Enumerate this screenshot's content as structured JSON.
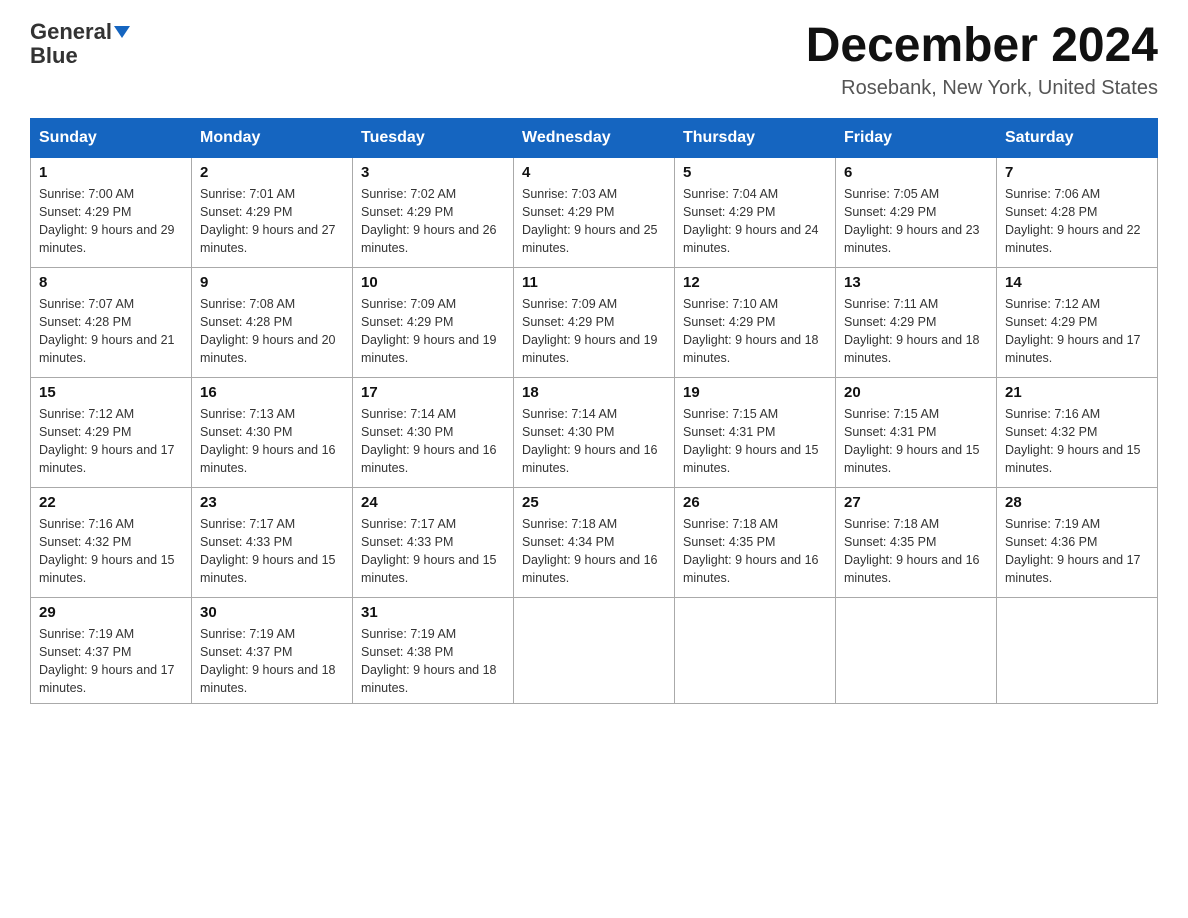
{
  "header": {
    "logo_general": "General",
    "logo_blue": "Blue",
    "month_title": "December 2024",
    "location": "Rosebank, New York, United States"
  },
  "days_of_week": [
    "Sunday",
    "Monday",
    "Tuesday",
    "Wednesday",
    "Thursday",
    "Friday",
    "Saturday"
  ],
  "weeks": [
    [
      {
        "num": "1",
        "sunrise": "7:00 AM",
        "sunset": "4:29 PM",
        "daylight": "9 hours and 29 minutes."
      },
      {
        "num": "2",
        "sunrise": "7:01 AM",
        "sunset": "4:29 PM",
        "daylight": "9 hours and 27 minutes."
      },
      {
        "num": "3",
        "sunrise": "7:02 AM",
        "sunset": "4:29 PM",
        "daylight": "9 hours and 26 minutes."
      },
      {
        "num": "4",
        "sunrise": "7:03 AM",
        "sunset": "4:29 PM",
        "daylight": "9 hours and 25 minutes."
      },
      {
        "num": "5",
        "sunrise": "7:04 AM",
        "sunset": "4:29 PM",
        "daylight": "9 hours and 24 minutes."
      },
      {
        "num": "6",
        "sunrise": "7:05 AM",
        "sunset": "4:29 PM",
        "daylight": "9 hours and 23 minutes."
      },
      {
        "num": "7",
        "sunrise": "7:06 AM",
        "sunset": "4:28 PM",
        "daylight": "9 hours and 22 minutes."
      }
    ],
    [
      {
        "num": "8",
        "sunrise": "7:07 AM",
        "sunset": "4:28 PM",
        "daylight": "9 hours and 21 minutes."
      },
      {
        "num": "9",
        "sunrise": "7:08 AM",
        "sunset": "4:28 PM",
        "daylight": "9 hours and 20 minutes."
      },
      {
        "num": "10",
        "sunrise": "7:09 AM",
        "sunset": "4:29 PM",
        "daylight": "9 hours and 19 minutes."
      },
      {
        "num": "11",
        "sunrise": "7:09 AM",
        "sunset": "4:29 PM",
        "daylight": "9 hours and 19 minutes."
      },
      {
        "num": "12",
        "sunrise": "7:10 AM",
        "sunset": "4:29 PM",
        "daylight": "9 hours and 18 minutes."
      },
      {
        "num": "13",
        "sunrise": "7:11 AM",
        "sunset": "4:29 PM",
        "daylight": "9 hours and 18 minutes."
      },
      {
        "num": "14",
        "sunrise": "7:12 AM",
        "sunset": "4:29 PM",
        "daylight": "9 hours and 17 minutes."
      }
    ],
    [
      {
        "num": "15",
        "sunrise": "7:12 AM",
        "sunset": "4:29 PM",
        "daylight": "9 hours and 17 minutes."
      },
      {
        "num": "16",
        "sunrise": "7:13 AM",
        "sunset": "4:30 PM",
        "daylight": "9 hours and 16 minutes."
      },
      {
        "num": "17",
        "sunrise": "7:14 AM",
        "sunset": "4:30 PM",
        "daylight": "9 hours and 16 minutes."
      },
      {
        "num": "18",
        "sunrise": "7:14 AM",
        "sunset": "4:30 PM",
        "daylight": "9 hours and 16 minutes."
      },
      {
        "num": "19",
        "sunrise": "7:15 AM",
        "sunset": "4:31 PM",
        "daylight": "9 hours and 15 minutes."
      },
      {
        "num": "20",
        "sunrise": "7:15 AM",
        "sunset": "4:31 PM",
        "daylight": "9 hours and 15 minutes."
      },
      {
        "num": "21",
        "sunrise": "7:16 AM",
        "sunset": "4:32 PM",
        "daylight": "9 hours and 15 minutes."
      }
    ],
    [
      {
        "num": "22",
        "sunrise": "7:16 AM",
        "sunset": "4:32 PM",
        "daylight": "9 hours and 15 minutes."
      },
      {
        "num": "23",
        "sunrise": "7:17 AM",
        "sunset": "4:33 PM",
        "daylight": "9 hours and 15 minutes."
      },
      {
        "num": "24",
        "sunrise": "7:17 AM",
        "sunset": "4:33 PM",
        "daylight": "9 hours and 15 minutes."
      },
      {
        "num": "25",
        "sunrise": "7:18 AM",
        "sunset": "4:34 PM",
        "daylight": "9 hours and 16 minutes."
      },
      {
        "num": "26",
        "sunrise": "7:18 AM",
        "sunset": "4:35 PM",
        "daylight": "9 hours and 16 minutes."
      },
      {
        "num": "27",
        "sunrise": "7:18 AM",
        "sunset": "4:35 PM",
        "daylight": "9 hours and 16 minutes."
      },
      {
        "num": "28",
        "sunrise": "7:19 AM",
        "sunset": "4:36 PM",
        "daylight": "9 hours and 17 minutes."
      }
    ],
    [
      {
        "num": "29",
        "sunrise": "7:19 AM",
        "sunset": "4:37 PM",
        "daylight": "9 hours and 17 minutes."
      },
      {
        "num": "30",
        "sunrise": "7:19 AM",
        "sunset": "4:37 PM",
        "daylight": "9 hours and 18 minutes."
      },
      {
        "num": "31",
        "sunrise": "7:19 AM",
        "sunset": "4:38 PM",
        "daylight": "9 hours and 18 minutes."
      },
      null,
      null,
      null,
      null
    ]
  ]
}
